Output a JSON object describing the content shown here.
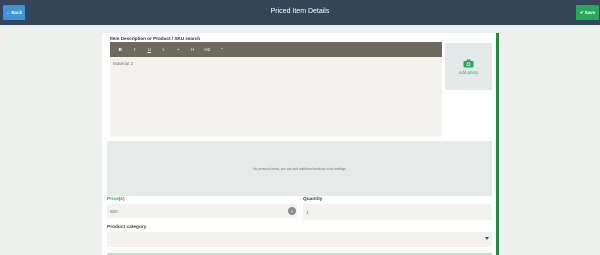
{
  "header": {
    "title": "Priced Item Details",
    "back_label": "Back",
    "save_label": "Save",
    "bar_color": "#35465a",
    "back_color": "#3b95d8",
    "save_color": "#27a85a"
  },
  "description": {
    "label": "Item Description or Product / SKU search",
    "editor_text": "Material 2",
    "toolbar": [
      "B",
      "I",
      "U",
      "I.",
      "•",
      "H",
      "H2",
      "\""
    ]
  },
  "photo": {
    "label": "Add photo",
    "icon": "camera-icon"
  },
  "notice": {
    "text": "No personal items, you can add additional sections in the settings"
  },
  "price": {
    "label": "Price(£)",
    "value": "500"
  },
  "quantity": {
    "label": "Quantity",
    "value": "1"
  },
  "category": {
    "label": "Product category",
    "value": ""
  },
  "accent_color": "#1f8a3e"
}
